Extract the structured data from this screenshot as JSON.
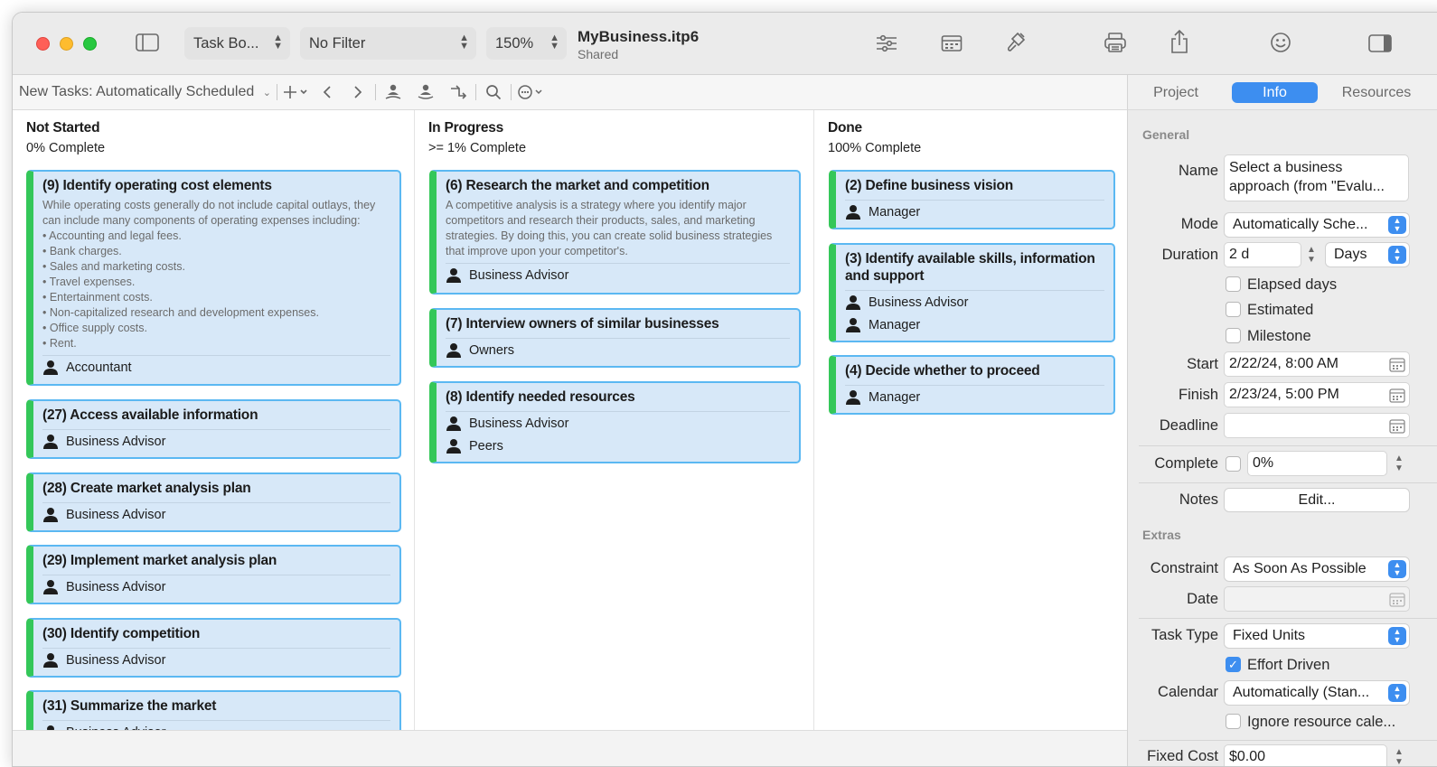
{
  "toolbar": {
    "view_popup": "Task Bo...",
    "filter_popup": "No Filter",
    "zoom_popup": "150%",
    "doc_title": "MyBusiness.itp6",
    "doc_subtitle": "Shared"
  },
  "subbar": {
    "schedule_mode": "New Tasks: Automatically Scheduled"
  },
  "inspector_tabs": [
    "Project",
    "Info",
    "Resources"
  ],
  "board": {
    "columns": [
      {
        "title": "Not Started",
        "subtitle": "0% Complete",
        "cards": [
          {
            "title": "(9) Identify operating cost elements",
            "notes": [
              "While operating costs generally do not include capital outlays, they",
              "can include many components of operating expenses including:",
              "• Accounting and legal fees.",
              "• Bank charges.",
              "• Sales and marketing costs.",
              "• Travel expenses.",
              "• Entertainment costs.",
              "• Non-capitalized research and development expenses.",
              "• Office supply costs.",
              "• Rent."
            ],
            "resources": [
              "Accountant"
            ]
          },
          {
            "title": "(27) Access available information",
            "resources": [
              "Business Advisor"
            ]
          },
          {
            "title": "(28) Create market analysis plan",
            "resources": [
              "Business Advisor"
            ]
          },
          {
            "title": "(29) Implement market analysis plan",
            "resources": [
              "Business Advisor"
            ]
          },
          {
            "title": "(30) Identify competition",
            "resources": [
              "Business Advisor"
            ]
          },
          {
            "title": "(31) Summarize the market",
            "resources": [
              "Business Advisor"
            ]
          }
        ]
      },
      {
        "title": "In Progress",
        "subtitle": ">= 1% Complete",
        "cards": [
          {
            "title": "(6) Research the market and competition",
            "notes": [
              "A competitive analysis is a strategy where you identify major",
              "competitors and research their products, sales, and marketing",
              "strategies. By doing this, you can create solid business strategies",
              "that improve upon your competitor's."
            ],
            "resources": [
              "Business Advisor"
            ]
          },
          {
            "title": "(7) Interview owners of similar businesses",
            "resources": [
              "Owners"
            ]
          },
          {
            "title": "(8) Identify needed resources",
            "resources": [
              "Business Advisor",
              "Peers"
            ]
          }
        ]
      },
      {
        "title": "Done",
        "subtitle": "100% Complete",
        "cards": [
          {
            "title": "(2) Define business vision",
            "resources": [
              "Manager"
            ]
          },
          {
            "title_line1": "(3) Identify available skills, information",
            "title_line2": "and support",
            "resources": [
              "Business Advisor",
              "Manager"
            ]
          },
          {
            "title": "(4) Decide whether to proceed",
            "resources": [
              "Manager"
            ]
          }
        ]
      }
    ]
  },
  "inspector": {
    "general_header": "General",
    "name_label": "Name",
    "name_line1": "Select a business",
    "name_line2": "approach (from \"Evalu...",
    "mode_label": "Mode",
    "mode_value": "Automatically Sche...",
    "duration_label": "Duration",
    "duration_value": "2 d",
    "duration_unit": "Days",
    "elapsed_label": "Elapsed days",
    "estimated_label": "Estimated",
    "milestone_label": "Milestone",
    "start_label": "Start",
    "start_value": "2/22/24, 8:00 AM",
    "finish_label": "Finish",
    "finish_value": "2/23/24, 5:00 PM",
    "deadline_label": "Deadline",
    "complete_label": "Complete",
    "complete_value": "0%",
    "notes_label": "Notes",
    "notes_button": "Edit...",
    "extras_header": "Extras",
    "constraint_label": "Constraint",
    "constraint_value": "As Soon As Possible",
    "date_label": "Date",
    "task_type_label": "Task Type",
    "task_type_value": "Fixed Units",
    "effort_driven_label": "Effort Driven",
    "calendar_label": "Calendar",
    "calendar_value": "Automatically (Stan...",
    "ignore_resource_label": "Ignore resource cale...",
    "fixed_cost_label": "Fixed Cost",
    "fixed_cost_value": "$0.00"
  },
  "colors": {
    "card_bg": "#d7e8f8",
    "card_border": "#5bb8f2",
    "card_accent": "#34c759",
    "accent_blue": "#3d8ef0"
  }
}
